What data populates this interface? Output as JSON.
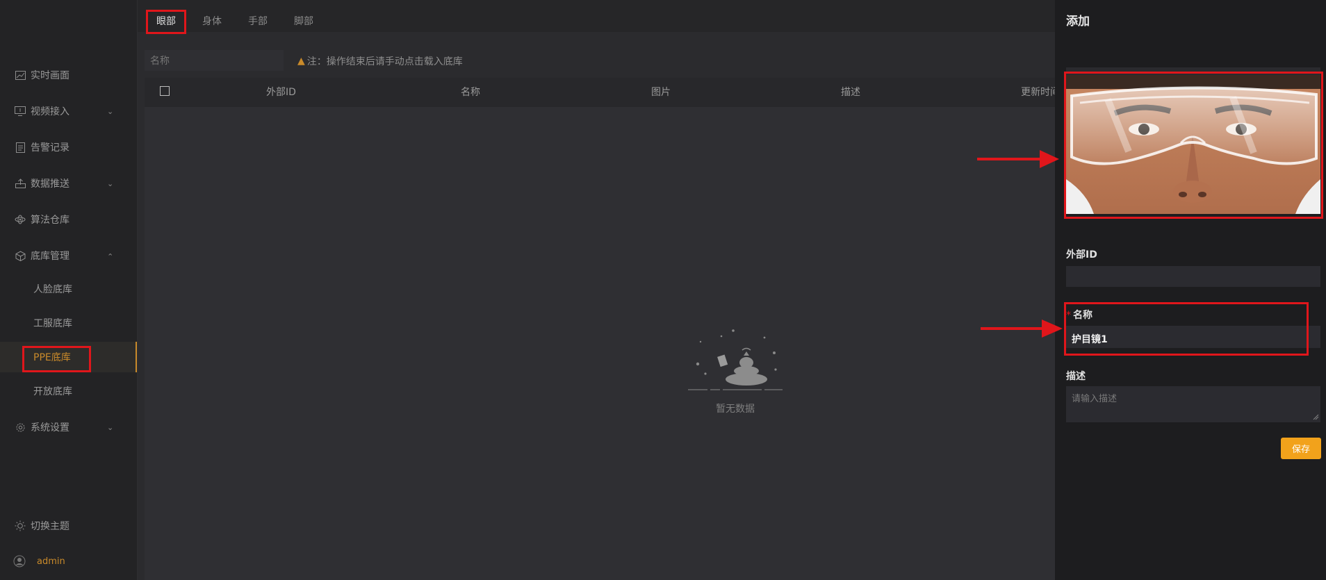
{
  "sidebar": {
    "items": [
      {
        "label": "实时画面",
        "icon": "chart-icon"
      },
      {
        "label": "视频接入",
        "icon": "monitor-icon"
      },
      {
        "label": "告警记录",
        "icon": "document-icon"
      },
      {
        "label": "数据推送",
        "icon": "upload-icon"
      },
      {
        "label": "算法仓库",
        "icon": "atom-icon"
      },
      {
        "label": "底库管理",
        "icon": "cube-icon"
      }
    ],
    "sub_items": [
      "人脸底库",
      "工服底库",
      "PPE底库",
      "开放底库"
    ],
    "settings": "系统设置",
    "theme": "切换主题",
    "user": "admin"
  },
  "tabs": [
    "眼部",
    "身体",
    "手部",
    "脚部"
  ],
  "toolbar": {
    "search_placeholder": "名称",
    "note": "注：操作结束后请手动点击载入底库"
  },
  "table": {
    "columns": [
      "外部ID",
      "名称",
      "图片",
      "描述",
      "更新时间"
    ],
    "empty_text": "暂无数据"
  },
  "drawer": {
    "title": "添加",
    "external_id_label": "外部ID",
    "external_id_value": "",
    "name_label": "名称",
    "name_value": "护目镜1",
    "desc_label": "描述",
    "desc_placeholder": "请输入描述",
    "save_label": "保存"
  },
  "colors": {
    "accent": "#c98a2a",
    "button": "#f2a21b",
    "highlight": "#e0161b"
  }
}
